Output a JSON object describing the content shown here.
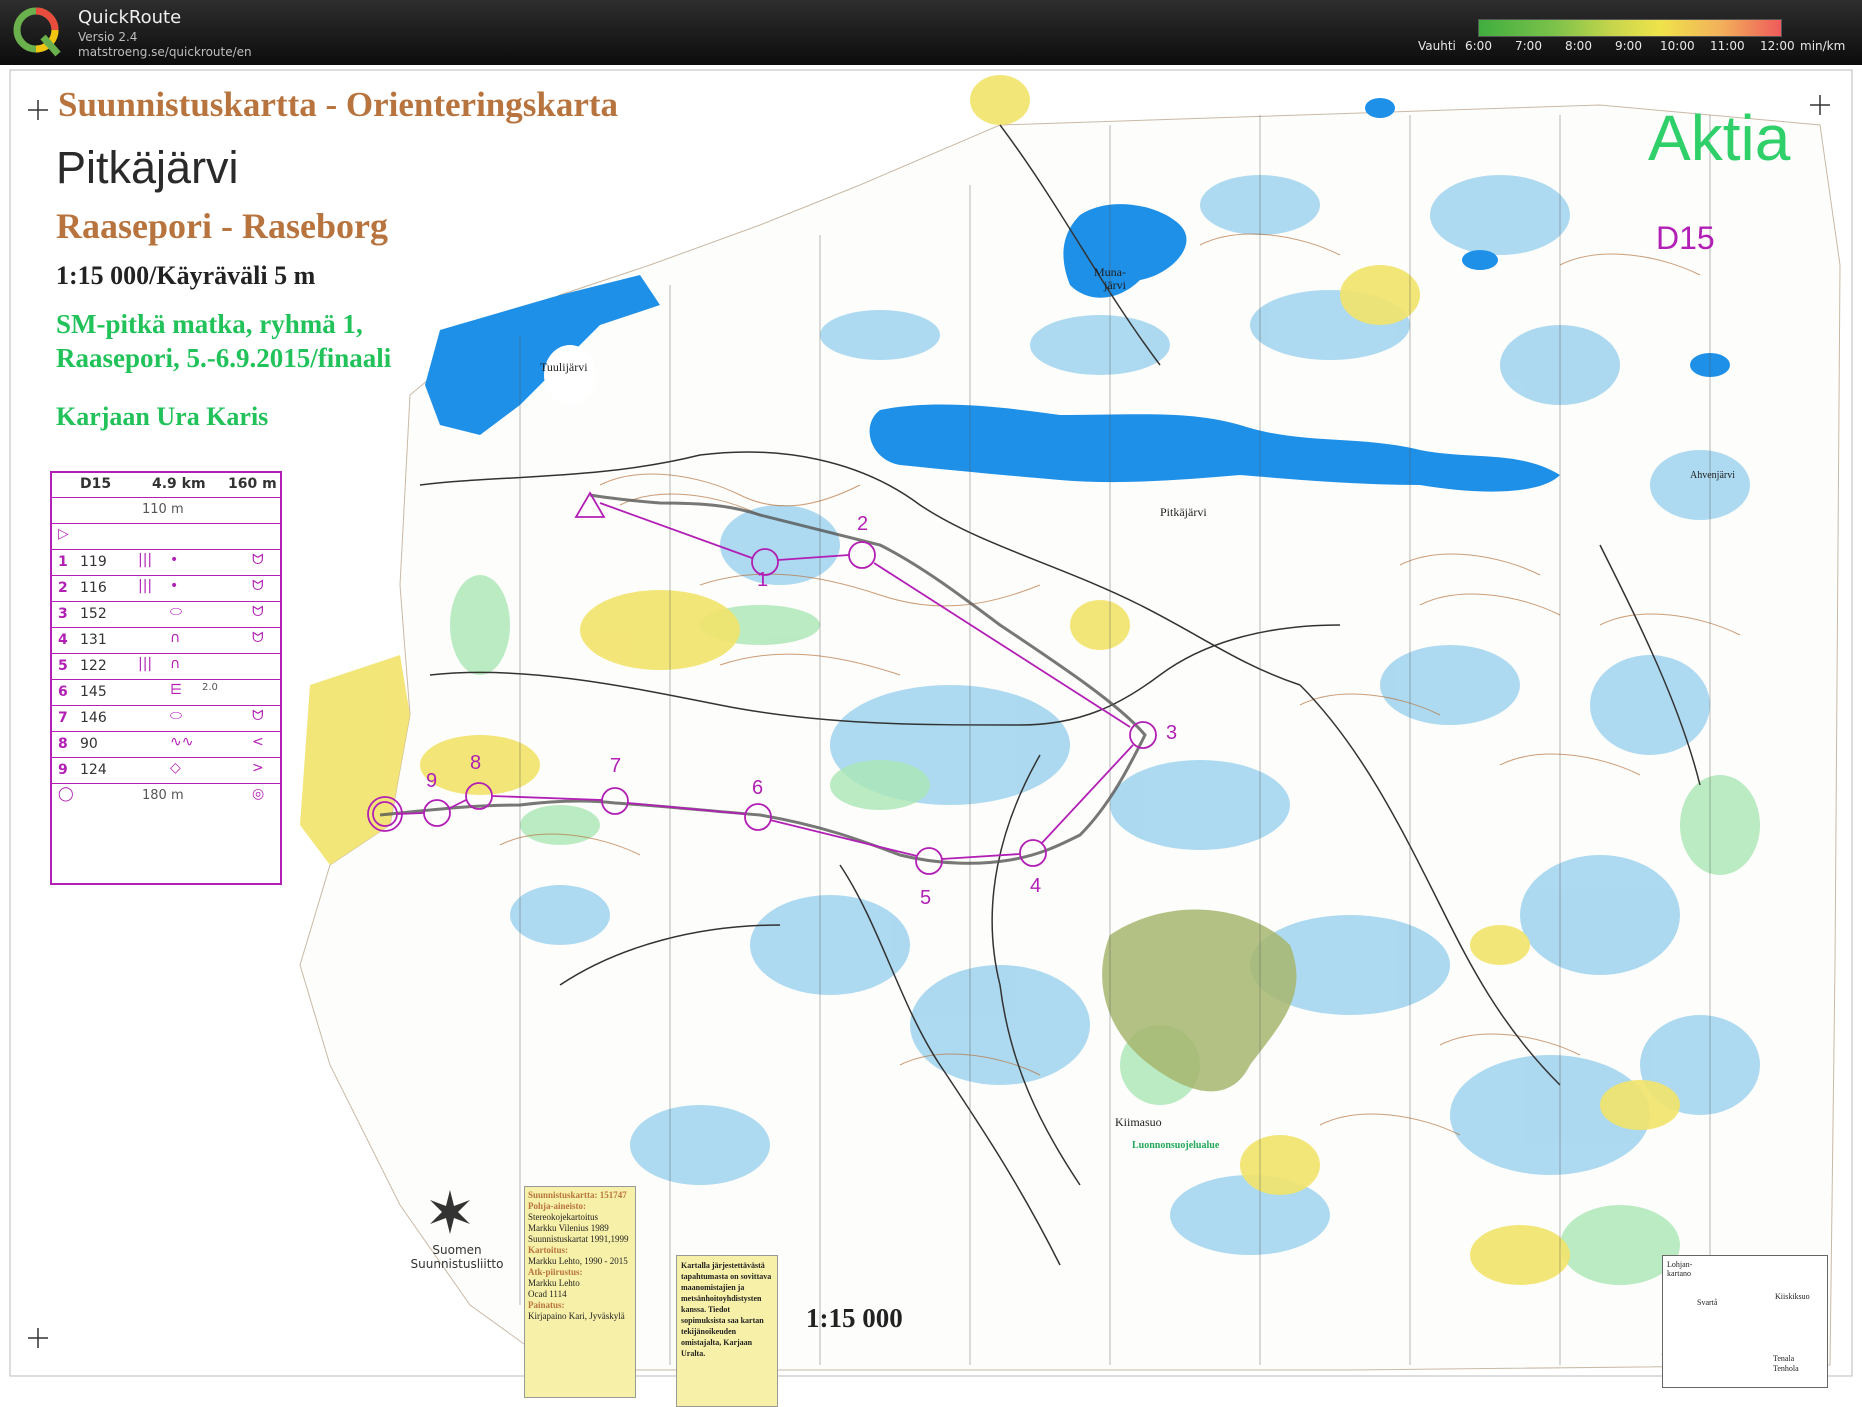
{
  "app": {
    "name": "QuickRoute",
    "version": "Versio 2.4",
    "url": "matstroeng.se/quickroute/en"
  },
  "pace_legend": {
    "label": "Vauhti",
    "ticks": [
      "6:00",
      "7:00",
      "8:00",
      "9:00",
      "10:00",
      "11:00",
      "12:00"
    ],
    "unit": "min/km",
    "colors": [
      "#3fae3f",
      "#7cc24a",
      "#c9d64b",
      "#efe34b",
      "#f2b15a",
      "#ef5b5b"
    ]
  },
  "map": {
    "heading_1": "Suunnistuskartta - Orienteringskarta",
    "heading_2": "Pitkäjärvi",
    "heading_3": "Raasepori - Raseborg",
    "scale_line": "1:15 000/Käyräväli 5 m",
    "event_line_1": "SM-pitkä matka, ryhmä 1,",
    "event_line_2": "Raasepori, 5.-6.9.2015/finaali",
    "club": "Karjaan Ura Karis",
    "sponsor": "Aktia",
    "course_class": "D15",
    "bottom_scale": "1:15 000",
    "federation": [
      "Suomen",
      "Suunnistusliitto"
    ],
    "place_names": [
      "Tuulijärvi",
      "Muna-",
      "järvi",
      "Pitkäjärvi",
      "Kiimasuo",
      "Luonnonsuojelualue",
      "Ahvenjärvi"
    ],
    "control_numbers": [
      "1",
      "2",
      "3",
      "4",
      "5",
      "6",
      "7",
      "8",
      "9"
    ],
    "colors": {
      "water": "#1e90e8",
      "marsh": "#9fd3ee",
      "open": "#f2e36a",
      "vegetation": "#a9e6b4",
      "course": "#b21fb5",
      "route": "#444444"
    }
  },
  "description_sheet": {
    "class": "D15",
    "length": "4.9 km",
    "climb": "160 m",
    "start_tape": "110 m",
    "finish_tape": "180 m",
    "rows": [
      {
        "n": "1",
        "code": "119",
        "f": "|||",
        "g": "•",
        "h": "ᗢ"
      },
      {
        "n": "2",
        "code": "116",
        "f": "|||",
        "g": "•",
        "h": "ᗢ"
      },
      {
        "n": "3",
        "code": "152",
        "f": "",
        "g": "⬭",
        "h": "ᗢ"
      },
      {
        "n": "4",
        "code": "131",
        "f": "",
        "g": "∩",
        "h": "ᗢ"
      },
      {
        "n": "5",
        "code": "122",
        "f": "|||",
        "g": "∩",
        "h": ""
      },
      {
        "n": "6",
        "code": "145",
        "f": "",
        "g": "⋿",
        "h": "2.0"
      },
      {
        "n": "7",
        "code": "146",
        "f": "",
        "g": "⬭",
        "h": "ᗢ"
      },
      {
        "n": "8",
        "code": "90",
        "f": "",
        "g": "∿∿",
        "h": "<"
      },
      {
        "n": "9",
        "code": "124",
        "f": "",
        "g": "◇",
        "h": ">"
      }
    ]
  },
  "info_box": {
    "lines": [
      "Suunnistuskartta: 151747",
      "Pohja-aineisto:",
      "Stereokojekartoitus",
      "Markku Vilenius 1989",
      "Suunnistuskartat 1991,1999",
      "Kartoitus:",
      "Markku Lehto, 1990 - 2015",
      "Atk-piirustus:",
      "Markku Lehto",
      "Ocad 1114",
      "Painatus:",
      "Kirjapaino Kari, Jyväskylä"
    ]
  },
  "notice": "Kartalla järjestettävästä tapahtumasta on sovittava maanomistajien ja metsänhoitoyhdistysten kanssa. Tiedot sopimuksista saa kartan tekijänoikeuden omistajalta, Karjaan Uralta.",
  "inset": {
    "labels": [
      "Lohjan-",
      "kartano",
      "Svartå",
      "Kiiskiksuo",
      "Tenala",
      "Tenhola"
    ]
  }
}
